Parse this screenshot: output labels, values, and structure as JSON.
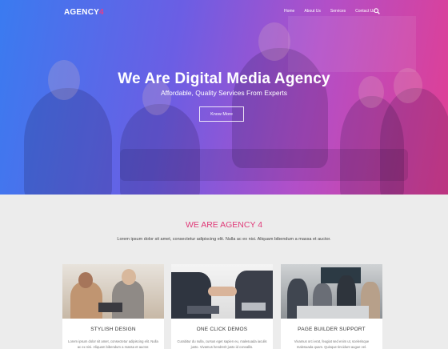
{
  "navbar": {
    "logo_text": "AGENCY",
    "logo_number": "4",
    "menu": [
      "Home",
      "About Us",
      "Services",
      "Contact Us"
    ]
  },
  "hero": {
    "title": "We Are Digital Media Agency",
    "subtitle": "Affordable, Quality Services From Experts",
    "button": "Know More"
  },
  "about": {
    "title": "WE ARE AGENCY 4",
    "text": "Lorem ipsum dolor sit amet, consectetur adipiscing elit. Nulla ac ex nisi. Aliquam bibendum a massa et auctor."
  },
  "cards": [
    {
      "title": "STYLISH DESIGN",
      "text": "Lorem ipsum dolor sit amet, consectetur adipiscing elit. Nulla ac ex nisi. Aliquam bibendum a massa et auctor."
    },
    {
      "title": "ONE CLICK DEMOS",
      "text": "Curabitur du nulla, cursus eget sapien eu, malesuada iaculis justo. Vivamus hendrerit justo id convallis."
    },
    {
      "title": "PAGE BUILDER SUPPORT",
      "text": "Vivamus orci erat, feugiat sed enim ut, scelerisque malesuada quam. Quisque tincidunt augue vel."
    }
  ],
  "colors": {
    "accent": "#e03a78",
    "gradient_start": "#3a7bf0",
    "gradient_end": "#e23e92"
  }
}
